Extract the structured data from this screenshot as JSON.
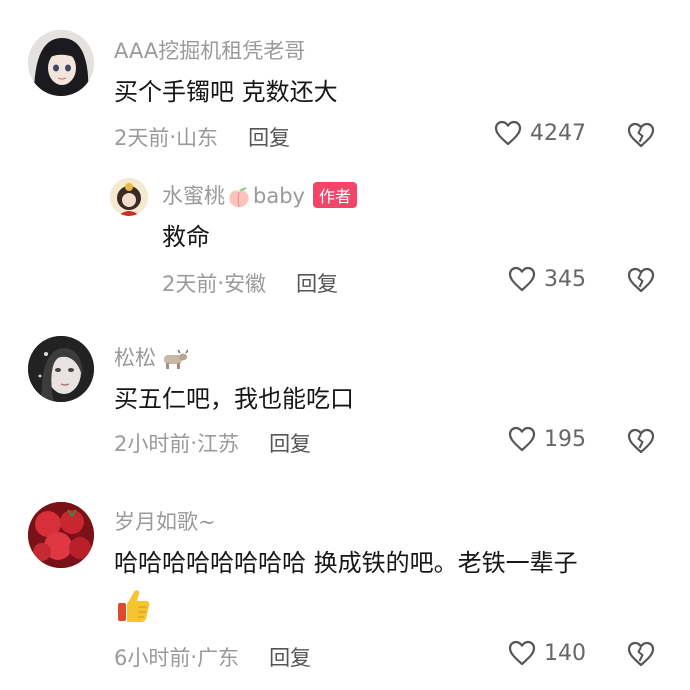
{
  "comments": [
    {
      "user": "AAA挖掘机租凭老哥",
      "text": "买个手镯吧 克数还大",
      "time": "2天前",
      "location": "山东",
      "reply": "回复",
      "likes": "4247"
    },
    {
      "user_name": "水蜜桃",
      "user_suffix": "baby",
      "badge": "作者",
      "text": "救命",
      "time": "2天前",
      "location": "安徽",
      "reply": "回复",
      "likes": "345"
    },
    {
      "user": "松松",
      "text": "买五仁吧，我也能吃口",
      "time": "2小时前",
      "location": "江苏",
      "reply": "回复",
      "likes": "195"
    },
    {
      "user": "岁月如歌~",
      "text": "哈哈哈哈哈哈哈哈 换成铁的吧。老铁一辈子",
      "time": "6小时前",
      "location": "广东",
      "reply": "回复",
      "likes": "140"
    }
  ],
  "separator": " · ",
  "icons": {
    "like": "heart-outline-icon",
    "dislike": "broken-heart-icon",
    "thumbs_up": "thumbs-up-emoji",
    "peach": "peach-emoji",
    "ox": "ox-emoji"
  },
  "colors": {
    "meta": "#9a9a9a",
    "text": "#161616",
    "badge": "#f2456a"
  }
}
